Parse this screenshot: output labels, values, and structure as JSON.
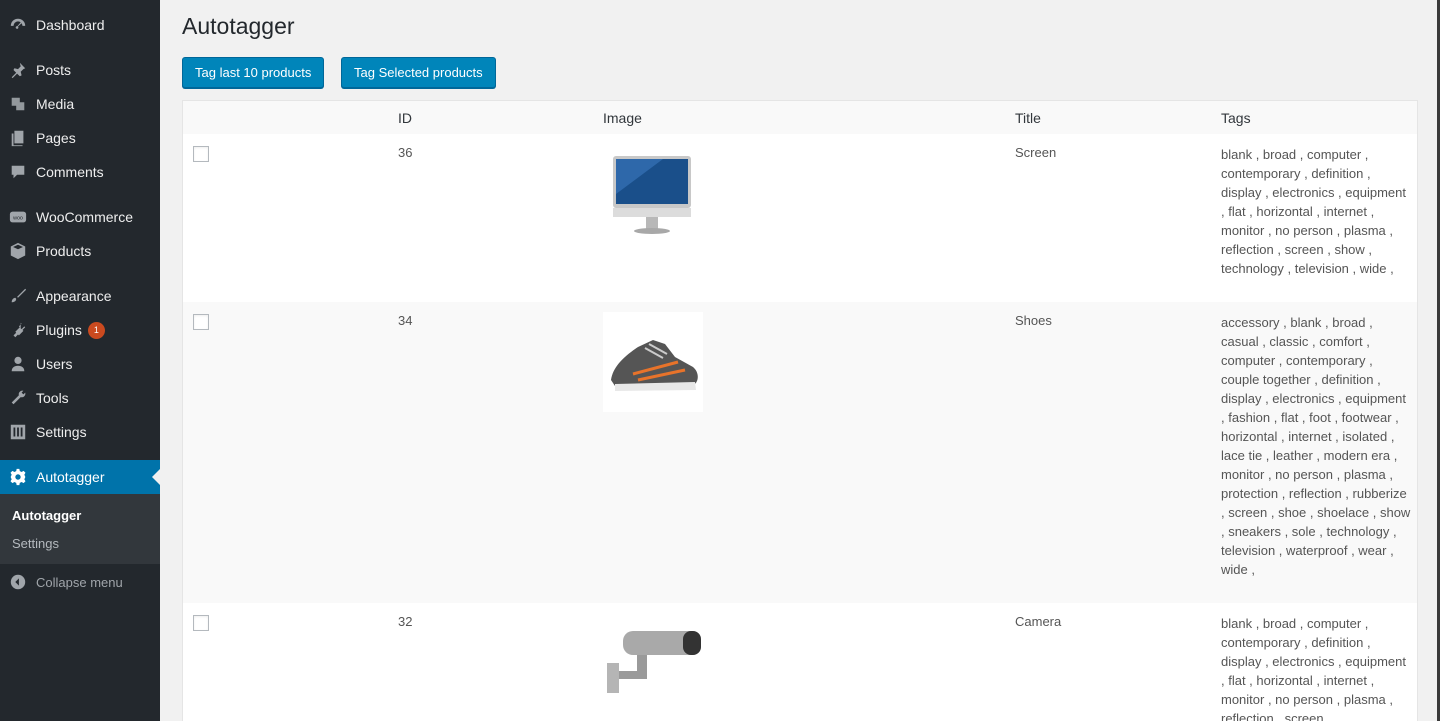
{
  "sidebar": {
    "items": [
      {
        "label": "Dashboard",
        "icon": "dashboard-icon"
      },
      {
        "label": "Posts",
        "icon": "pushpin-icon"
      },
      {
        "label": "Media",
        "icon": "media-icon"
      },
      {
        "label": "Pages",
        "icon": "pages-icon"
      },
      {
        "label": "Comments",
        "icon": "comment-icon"
      },
      {
        "label": "WooCommerce",
        "icon": "woo-icon"
      },
      {
        "label": "Products",
        "icon": "box-icon"
      },
      {
        "label": "Appearance",
        "icon": "brush-icon"
      },
      {
        "label": "Plugins",
        "icon": "plug-icon",
        "badge": "1"
      },
      {
        "label": "Users",
        "icon": "user-icon"
      },
      {
        "label": "Tools",
        "icon": "wrench-icon"
      },
      {
        "label": "Settings",
        "icon": "sliders-icon"
      },
      {
        "label": "Autotagger",
        "icon": "gear-icon"
      }
    ],
    "submenu": [
      "Autotagger",
      "Settings"
    ],
    "collapse_label": "Collapse menu"
  },
  "page": {
    "title": "Autotagger",
    "btn_last10": "Tag last 10 products",
    "btn_selected": "Tag Selected products"
  },
  "table": {
    "headers": [
      "ID",
      "Image",
      "Title",
      "Tags"
    ],
    "rows": [
      {
        "id": "36",
        "title": "Screen",
        "image": "monitor",
        "tags": "blank , broad , computer , contemporary , definition , display , electronics , equipment , flat , horizontal , internet , monitor , no person , plasma , reflection , screen , show , technology , television , wide ,"
      },
      {
        "id": "34",
        "title": "Shoes",
        "image": "shoe",
        "tags": "accessory , blank , broad , casual , classic , comfort , computer , contemporary , couple together , definition , display , electronics , equipment , fashion , flat , foot , footwear , horizontal , internet , isolated , lace tie , leather , modern era , monitor , no person , plasma , protection , reflection , rubberize , screen , shoe , shoelace , show , sneakers , sole , technology , television , waterproof , wear , wide ,"
      },
      {
        "id": "32",
        "title": "Camera",
        "image": "camera",
        "tags": "blank , broad , computer , contemporary , definition , display , electronics , equipment , flat , horizontal , internet , monitor , no person , plasma , reflection , screen ,"
      }
    ]
  },
  "colors": {
    "sidebar_bg": "#23282d",
    "active_bg": "#0073aa",
    "button_bg": "#0085ba"
  }
}
